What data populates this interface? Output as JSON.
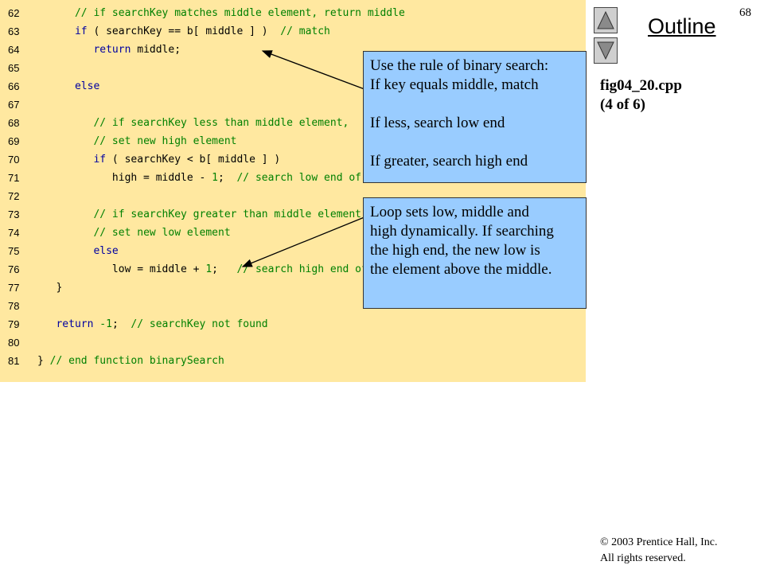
{
  "code": {
    "lines": [
      {
        "num": "62",
        "tokens": [
          {
            "t": "      ",
            "c": "tx"
          },
          {
            "t": "// if searchKey matches middle element, return middle",
            "c": "cm"
          }
        ]
      },
      {
        "num": "63",
        "tokens": [
          {
            "t": "      ",
            "c": "tx"
          },
          {
            "t": "if",
            "c": "kw"
          },
          {
            "t": " ( searchKey == b[ middle ] )  ",
            "c": "tx"
          },
          {
            "t": "// match",
            "c": "cm"
          }
        ]
      },
      {
        "num": "64",
        "tokens": [
          {
            "t": "         ",
            "c": "tx"
          },
          {
            "t": "return",
            "c": "kw"
          },
          {
            "t": " middle;",
            "c": "tx"
          }
        ]
      },
      {
        "num": "65",
        "tokens": []
      },
      {
        "num": "66",
        "tokens": [
          {
            "t": "      ",
            "c": "tx"
          },
          {
            "t": "else",
            "c": "kw"
          }
        ]
      },
      {
        "num": "67",
        "tokens": []
      },
      {
        "num": "68",
        "tokens": [
          {
            "t": "         ",
            "c": "tx"
          },
          {
            "t": "// if searchKey less than middle element,",
            "c": "cm"
          }
        ]
      },
      {
        "num": "69",
        "tokens": [
          {
            "t": "         ",
            "c": "tx"
          },
          {
            "t": "// set new high element",
            "c": "cm"
          }
        ]
      },
      {
        "num": "70",
        "tokens": [
          {
            "t": "         ",
            "c": "tx"
          },
          {
            "t": "if",
            "c": "kw"
          },
          {
            "t": " ( searchKey < b[ middle ] )",
            "c": "tx"
          }
        ]
      },
      {
        "num": "71",
        "tokens": [
          {
            "t": "            high = middle - ",
            "c": "tx"
          },
          {
            "t": "1",
            "c": "nm"
          },
          {
            "t": ";  ",
            "c": "tx"
          },
          {
            "t": "// search low end of array",
            "c": "cm"
          }
        ]
      },
      {
        "num": "72",
        "tokens": []
      },
      {
        "num": "73",
        "tokens": [
          {
            "t": "         ",
            "c": "tx"
          },
          {
            "t": "// if searchKey greater than middle element,",
            "c": "cm"
          }
        ]
      },
      {
        "num": "74",
        "tokens": [
          {
            "t": "         ",
            "c": "tx"
          },
          {
            "t": "// set new low element",
            "c": "cm"
          }
        ]
      },
      {
        "num": "75",
        "tokens": [
          {
            "t": "         ",
            "c": "tx"
          },
          {
            "t": "else",
            "c": "kw"
          }
        ]
      },
      {
        "num": "76",
        "tokens": [
          {
            "t": "            low = middle + ",
            "c": "tx"
          },
          {
            "t": "1",
            "c": "nm"
          },
          {
            "t": ";   ",
            "c": "tx"
          },
          {
            "t": "// search high end of array",
            "c": "cm"
          }
        ]
      },
      {
        "num": "77",
        "tokens": [
          {
            "t": "   }",
            "c": "tx"
          }
        ]
      },
      {
        "num": "78",
        "tokens": []
      },
      {
        "num": "79",
        "tokens": [
          {
            "t": "   ",
            "c": "tx"
          },
          {
            "t": "return",
            "c": "kw"
          },
          {
            "t": " ",
            "c": "tx"
          },
          {
            "t": "-1",
            "c": "nm"
          },
          {
            "t": ";  ",
            "c": "tx"
          },
          {
            "t": "// searchKey not found",
            "c": "cm"
          }
        ]
      },
      {
        "num": "80",
        "tokens": []
      },
      {
        "num": "81",
        "tokens": [
          {
            "t": "} ",
            "c": "tx"
          },
          {
            "t": "// end function binarySearch",
            "c": "cm"
          }
        ]
      }
    ]
  },
  "callouts": [
    {
      "lines": [
        "Use the rule of binary search:",
        "If key equals middle, match",
        "",
        "If less, search low end",
        "",
        "If greater, search high end"
      ]
    },
    {
      "lines": [
        "Loop sets low, middle and",
        "high dynamically. If searching",
        "the high end, the new low is",
        "the element above the middle."
      ]
    }
  ],
  "sidebar": {
    "slide_number": "68",
    "outline_title": "Outline",
    "file_name": "fig04_20.cpp",
    "file_part": "(4 of 6)",
    "copyright_line1": "© 2003 Prentice Hall, Inc.",
    "copyright_line2": "All rights reserved.",
    "up_icon": "up-triangle-icon",
    "down_icon": "down-triangle-icon"
  },
  "colors": {
    "code_background": "#ffe8a0",
    "callout_background": "#99ccff",
    "keyword": "#0000a0",
    "comment": "#008000"
  }
}
